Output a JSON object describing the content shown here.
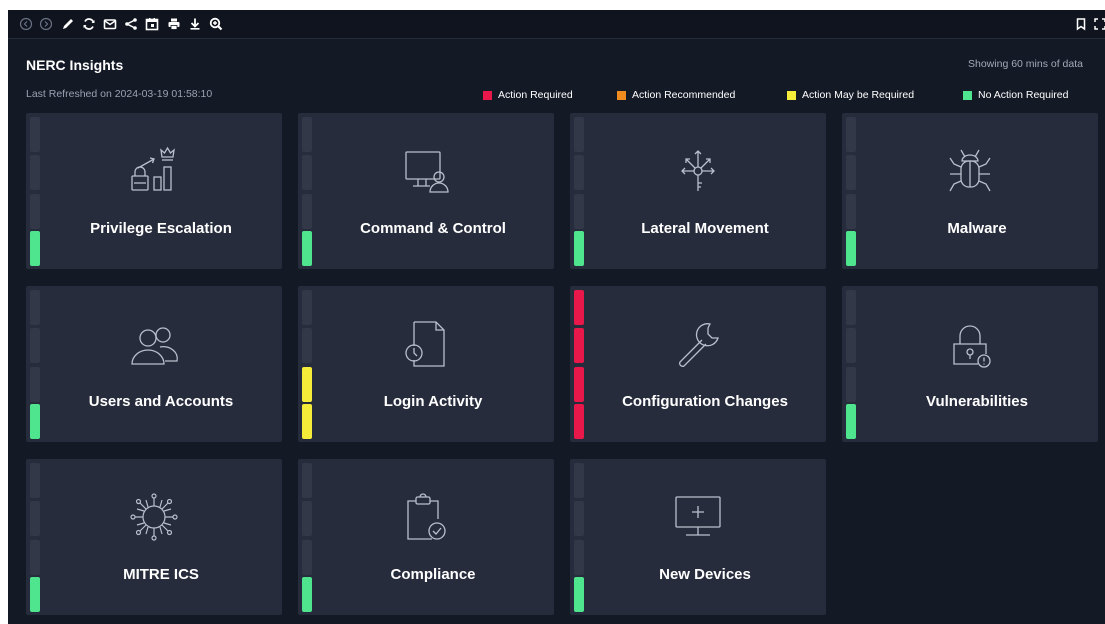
{
  "toolbar": {
    "left_icons": [
      "back-icon",
      "forward-icon",
      "pencil-icon",
      "refresh-icon",
      "email-icon",
      "share-icon",
      "calendar-icon",
      "print-icon",
      "download-icon",
      "zoom-in-icon"
    ],
    "right_icons": [
      "bookmark-icon",
      "fullscreen-icon"
    ]
  },
  "header": {
    "title": "NERC Insights",
    "last_refreshed": "Last Refreshed on 2024-03-19  01:58:10",
    "showing": "Showing 60 mins of data"
  },
  "legend": [
    {
      "label": "Action Required",
      "color": "#e8194a"
    },
    {
      "label": "Action Recommended",
      "color": "#f08c1e"
    },
    {
      "label": "Action May be Required",
      "color": "#f5ec3a"
    },
    {
      "label": "No Action Required",
      "color": "#4ee58e"
    }
  ],
  "status_colors": {
    "empty": "#323848",
    "green": "#4ee58e",
    "yellow": "#f5ec3a",
    "red": "#e8194a"
  },
  "cards": [
    {
      "label": "Privilege Escalation",
      "icon": "privilege-escalation-icon",
      "levels": [
        "empty",
        "empty",
        "empty",
        "green"
      ]
    },
    {
      "label": "Command & Control",
      "icon": "command-control-icon",
      "levels": [
        "empty",
        "empty",
        "empty",
        "green"
      ]
    },
    {
      "label": "Lateral Movement",
      "icon": "lateral-movement-icon",
      "levels": [
        "empty",
        "empty",
        "empty",
        "green"
      ]
    },
    {
      "label": "Malware",
      "icon": "malware-bug-icon",
      "levels": [
        "empty",
        "empty",
        "empty",
        "green"
      ]
    },
    {
      "label": "Users and Accounts",
      "icon": "users-icon",
      "levels": [
        "empty",
        "empty",
        "empty",
        "green"
      ]
    },
    {
      "label": "Login Activity",
      "icon": "login-activity-icon",
      "levels": [
        "empty",
        "empty",
        "yellow",
        "yellow"
      ]
    },
    {
      "label": "Configuration Changes",
      "icon": "wrench-icon",
      "levels": [
        "red",
        "red",
        "red",
        "red"
      ]
    },
    {
      "label": "Vulnerabilities",
      "icon": "vulnerability-lock-icon",
      "levels": [
        "empty",
        "empty",
        "empty",
        "green"
      ]
    },
    {
      "label": "MITRE ICS",
      "icon": "mitre-virus-icon",
      "levels": [
        "empty",
        "empty",
        "empty",
        "green"
      ]
    },
    {
      "label": "Compliance",
      "icon": "compliance-clipboard-icon",
      "levels": [
        "empty",
        "empty",
        "empty",
        "green"
      ]
    },
    {
      "label": "New Devices",
      "icon": "new-device-icon",
      "levels": [
        "empty",
        "empty",
        "empty",
        "green"
      ]
    }
  ]
}
